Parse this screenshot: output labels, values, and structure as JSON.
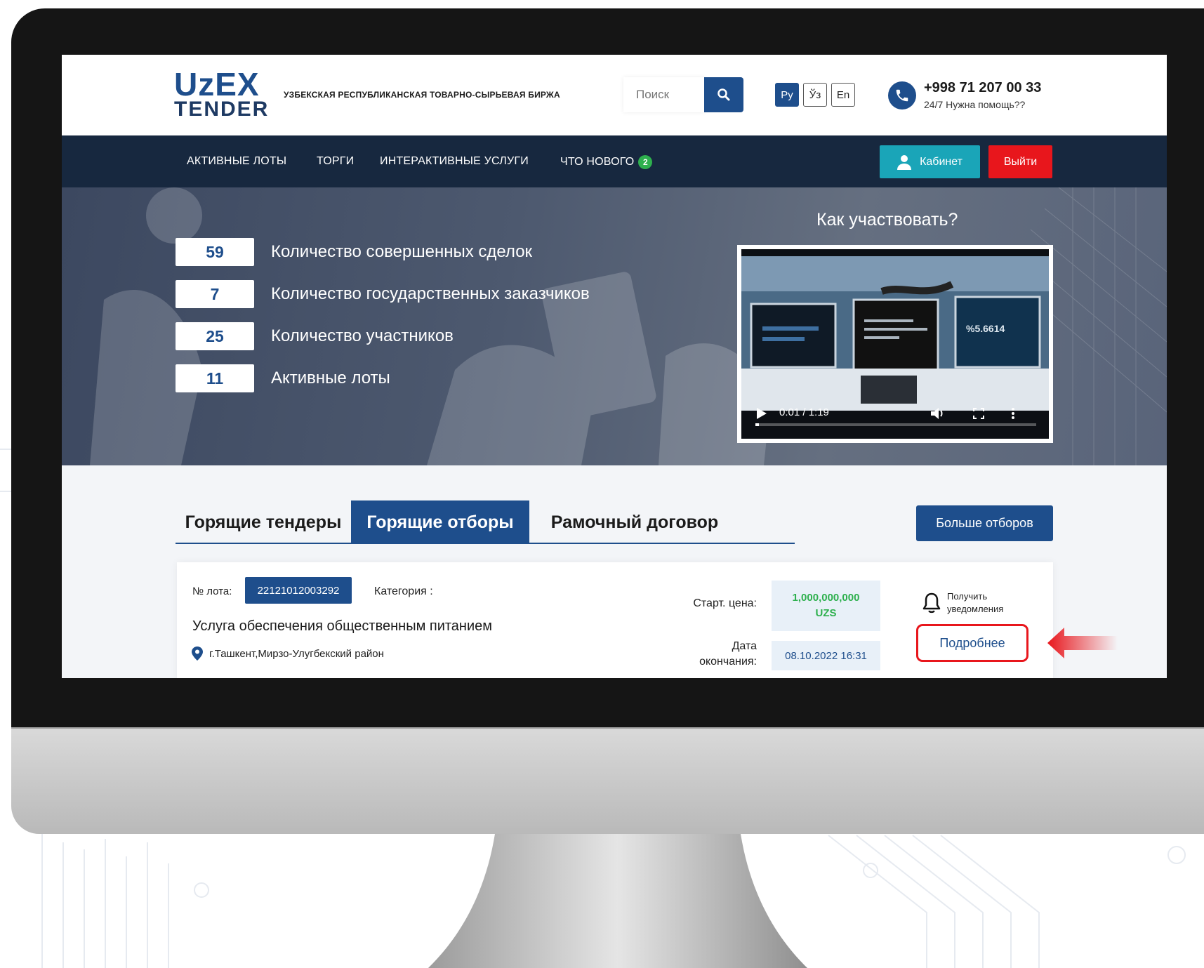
{
  "header": {
    "logo_line1": "UzEX",
    "logo_line2": "TENDER",
    "tagline": "УЗБЕКСКАЯ РЕСПУБЛИКАНСКАЯ ТОВАРНО-СЫРЬЕВАЯ БИРЖА",
    "search_placeholder": "Поиск",
    "languages": [
      "Ру",
      "Ўз",
      "En"
    ],
    "active_language": "Ру",
    "phone": "+998 71 207 00 33",
    "help": "24/7 Нужна помощь??"
  },
  "nav": {
    "items": [
      "АКТИВНЫЕ ЛОТЫ",
      "ТОРГИ",
      "ИНТЕРАКТИВНЫЕ УСЛУГИ",
      "ЧТО НОВОГО"
    ],
    "news_badge": "2",
    "cabinet_label": "Кабинет",
    "logout_label": "Выйти"
  },
  "hero": {
    "stats": [
      {
        "value": "59",
        "label": "Количество совершенных сделок"
      },
      {
        "value": "7",
        "label": "Количество государственных заказчиков"
      },
      {
        "value": "25",
        "label": "Количество участников"
      },
      {
        "value": "11",
        "label": "Активные лоты"
      }
    ],
    "how_title": "Как участвовать?",
    "video_time": "0:01 / 1:19",
    "video_progress": 0.013
  },
  "tabs": {
    "items": [
      "Горящие тендеры",
      "Горящие отборы",
      "Рамочный договор"
    ],
    "active": "Горящие отборы",
    "more_label": "Больше отборов"
  },
  "lot": {
    "number_label": "№ лота:",
    "number": "22121012003292",
    "category_label": "Категория :",
    "title": "Услуга обеспечения общественным питанием",
    "location": "г.Ташкент,Мирзо-Улугбекский район",
    "start_price_label": "Старт. цена:",
    "start_price": "1,000,000,000",
    "currency": "UZS",
    "end_date_label_1": "Дата",
    "end_date_label_2": "окончания:",
    "end_date": "08.10.2022 16:31",
    "notify_line1": "Получить",
    "notify_line2": "уведомления",
    "details_label": "Подробнее"
  },
  "colors": {
    "primary": "#1e4e8c",
    "nav_bg": "#17283f",
    "cabinet": "#1aa5b8",
    "logout": "#e8161c",
    "price_green": "#2eb04e"
  }
}
